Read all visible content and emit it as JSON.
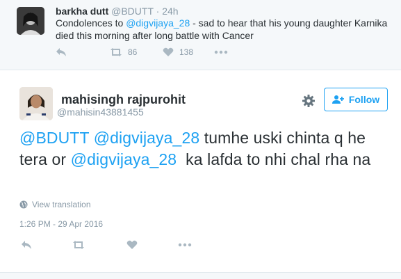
{
  "parent_tweet": {
    "name": "barkha dutt",
    "handle": "@BDUTT",
    "separator": "·",
    "time": "24h",
    "text_before": "Condolences to ",
    "mention": "@digvijaya_28",
    "text_after": " - sad to hear that his young daughter Karnika died this morning after long battle with Cancer",
    "retweet_count": "86",
    "like_count": "138"
  },
  "main_tweet": {
    "name": "mahisingh rajpurohit",
    "handle": "@mahisin43881455",
    "follow_label": "Follow",
    "mention_1": "@BDUTT",
    "mention_2": "@digvijaya_28",
    "text_1": " tumhe uski chinta q he tera or ",
    "mention_3": "@digvijaya_28",
    "text_2": "  ka lafda to nhi chal rha na",
    "translate_label": "View translation",
    "timestamp": "1:26 PM - 29 Apr 2016"
  },
  "colors": {
    "link": "#1da1f2",
    "muted": "#8899a6",
    "text": "#292f33",
    "background_parent": "#f5f8fa"
  },
  "icons": [
    "reply-icon",
    "retweet-icon",
    "like-icon",
    "more-icon",
    "gear-icon",
    "follow-person-icon",
    "globe-icon"
  ]
}
